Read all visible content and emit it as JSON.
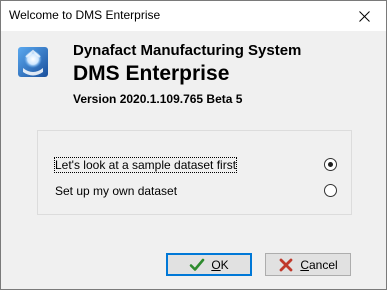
{
  "window": {
    "title": "Welcome to DMS Enterprise"
  },
  "header": {
    "company": "Dynafact Manufacturing System",
    "product": "DMS Enterprise",
    "version": "Version 2020.1.109.765 Beta 5",
    "logo_icon": "dms-logo-icon"
  },
  "options": [
    {
      "label": "Let's look at a sample dataset first",
      "selected": true
    },
    {
      "label": "Set up my own dataset",
      "selected": false
    }
  ],
  "buttons": {
    "ok": {
      "mnemonic": "O",
      "rest": "K",
      "icon": "checkmark-icon"
    },
    "cancel": {
      "mnemonic": "C",
      "rest": "ancel",
      "icon": "x-icon"
    }
  },
  "colors": {
    "focus_border": "#0078d7",
    "ok_check": "#2e8b2e",
    "cancel_x": "#c0392b"
  }
}
